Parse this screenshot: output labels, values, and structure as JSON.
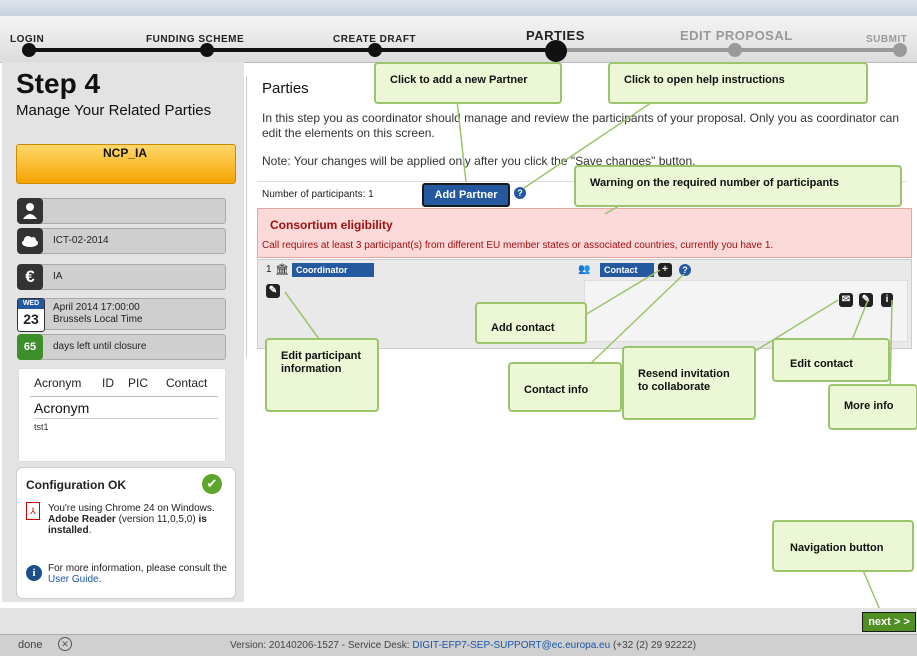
{
  "steps": [
    {
      "label": "LOGIN",
      "state": "done"
    },
    {
      "label": "FUNDING SCHEME",
      "state": "done"
    },
    {
      "label": "CREATE DRAFT",
      "state": "done"
    },
    {
      "label": "PARTIES",
      "state": "current"
    },
    {
      "label": "EDIT PROPOSAL",
      "state": "future"
    },
    {
      "label": "SUBMIT",
      "state": "future"
    }
  ],
  "sidebar": {
    "step_title": "Step 4",
    "step_subtitle": "Manage Your Related Parties",
    "organisation": "NCP_IA",
    "rows": [
      {
        "icon": "person-icon",
        "text": ""
      },
      {
        "icon": "cloud-icon",
        "text": "ICT-02-2014"
      },
      {
        "icon": "euro-icon",
        "text": "IA"
      },
      {
        "icon": "calendar-icon",
        "cal_day": "WED",
        "cal_date": "23",
        "text": "April 2014 17:00:00",
        "text2": "Brussels Local Time"
      },
      {
        "icon": "days-badge",
        "badge": "65",
        "text": "days left until closure"
      }
    ],
    "tabs": [
      "Acronym",
      "ID",
      "PIC",
      "Contact"
    ],
    "acronym_label": "Acronym",
    "acronym_value": "tst1",
    "config": {
      "title": "Configuration OK",
      "browser_line": "You're using Chrome 24 on Windows.",
      "reader_bold": "Adobe Reader",
      "reader_version": "(version 11,0,5,0)",
      "reader_is": "is",
      "installed": "installed",
      "more_prefix": "For more information, please consult the",
      "more_link": "User Guide",
      "more_suffix": "."
    }
  },
  "main": {
    "title": "Parties",
    "intro": "In this step you as coordinator should manage and review the participants of your proposal. Only you as coordinator can edit the elements on this screen.",
    "note": "Note: Your changes will be applied only after you click the \"Save changes\" button.",
    "participants_label": "Number of participants: 1",
    "add_partner_label": "Add Partner",
    "consortium_title": "Consortium eligibility",
    "consortium_message": "Call requires at least 3 participant(s) from different EU member states or associated countries, currently you have 1.",
    "coordinator_number": "1",
    "coordinator_label": "Coordinator",
    "contact_label": "Contact"
  },
  "callouts": {
    "add_partner": "Click to add a new Partner",
    "help": "Click to open help instructions",
    "warning": "Warning on the required number of participants",
    "add_contact": "Add contact",
    "edit_participant": "Edit participant information",
    "contact_info": "Contact info",
    "resend": "Resend invitation to collaborate",
    "edit_contact": "Edit contact",
    "more_info": "More info",
    "navigation": "Navigation button"
  },
  "nav": {
    "next_label": "next > >"
  },
  "status": {
    "done": "done",
    "version_prefix": "Version: 20140206-1527 - Service Desk:",
    "email": "DIGIT-EFP7-SEP-SUPPORT@ec.europa.eu",
    "phone": "(+32 (2) 29 92222)"
  },
  "colors": {
    "accent_blue": "#2459a0",
    "warning_red": "#a01010",
    "callout_green": "#ecf7d6",
    "next_green": "#4f8f24"
  }
}
